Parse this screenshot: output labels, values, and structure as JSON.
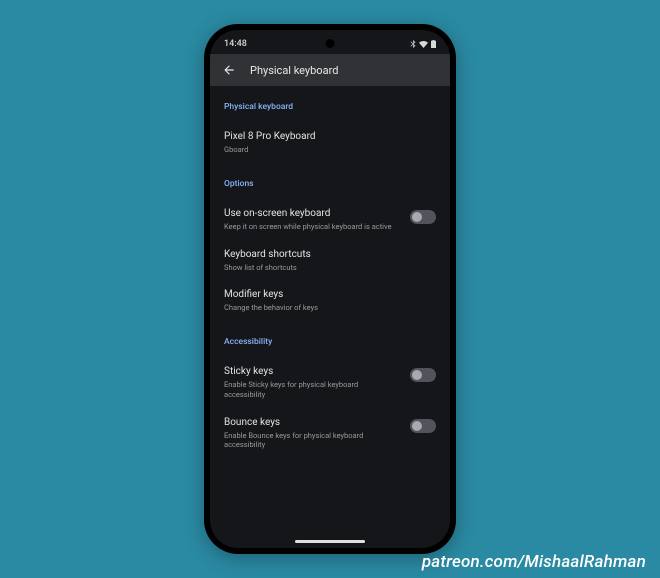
{
  "status_bar": {
    "time": "14:48"
  },
  "header": {
    "title": "Physical keyboard"
  },
  "section1": {
    "heading": "Physical keyboard",
    "keyboard_name": "Pixel 8 Pro Keyboard",
    "keyboard_app": "Gboard"
  },
  "section2": {
    "heading": "Options",
    "onscreen_title": "Use on-screen keyboard",
    "onscreen_sub": "Keep it on screen while physical keyboard is active",
    "shortcuts_title": "Keyboard shortcuts",
    "shortcuts_sub": "Show list of shortcuts",
    "modifier_title": "Modifier keys",
    "modifier_sub": "Change the behavior of keys"
  },
  "section3": {
    "heading": "Accessibility",
    "sticky_title": "Sticky keys",
    "sticky_sub": "Enable Sticky keys for physical keyboard accessibility",
    "bounce_title": "Bounce keys",
    "bounce_sub": "Enable Bounce keys for physical keyboard accessibility"
  },
  "footer": {
    "credit": "patreon.com/MishaalRahman"
  }
}
